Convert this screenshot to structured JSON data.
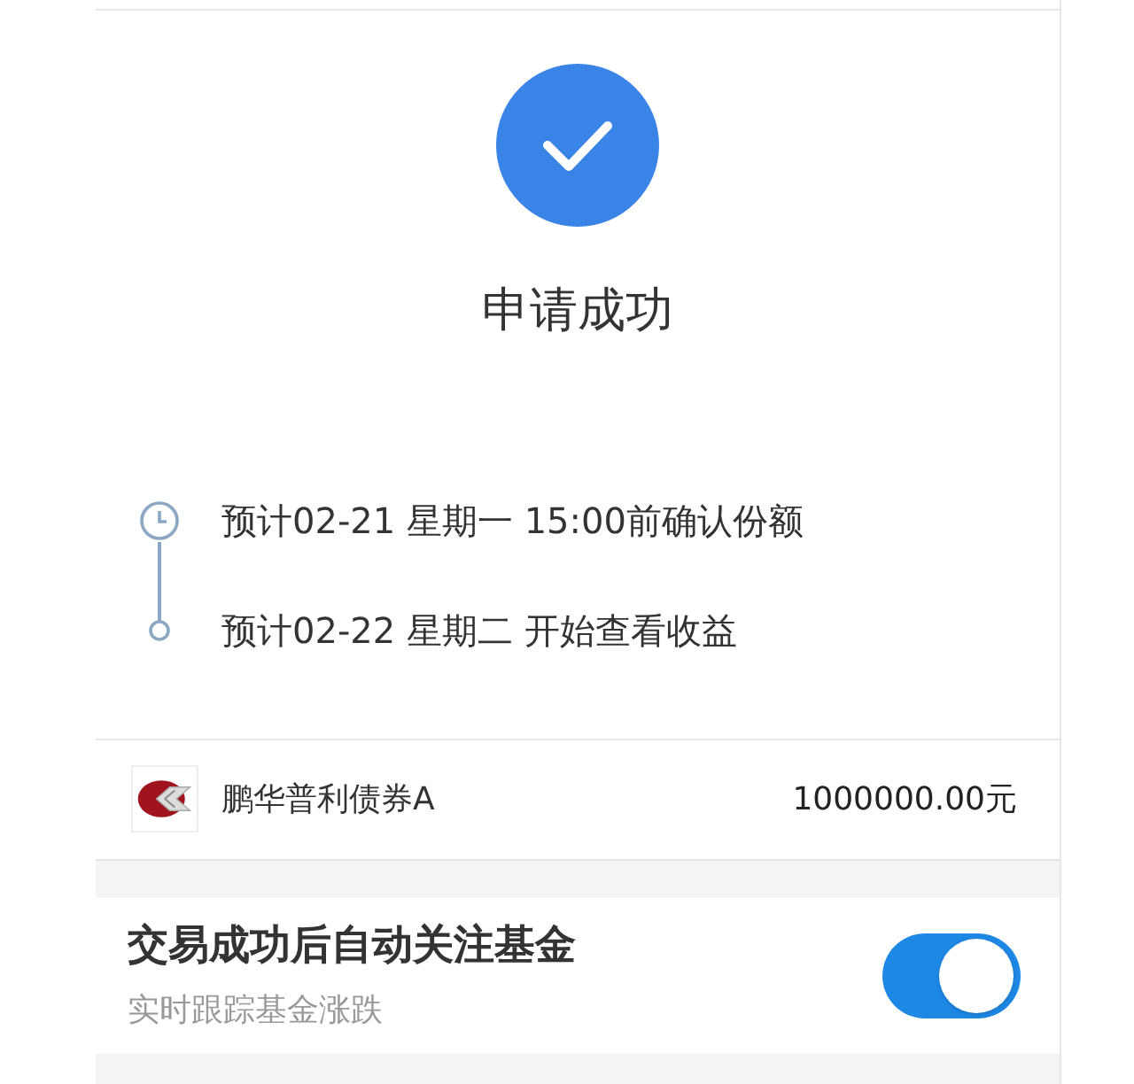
{
  "status": {
    "title": "申请成功"
  },
  "timeline": [
    {
      "kind": "clock",
      "text": "预计02-21 星期一 15:00前确认份额"
    },
    {
      "kind": "dot",
      "text": "预计02-22 星期二 开始查看收益"
    }
  ],
  "fund": {
    "name": "鹏华普利债券A",
    "amount": "1000000.00元"
  },
  "follow": {
    "title": "交易成功后自动关注基金",
    "subtitle": "实时跟踪基金涨跌",
    "on": true
  }
}
